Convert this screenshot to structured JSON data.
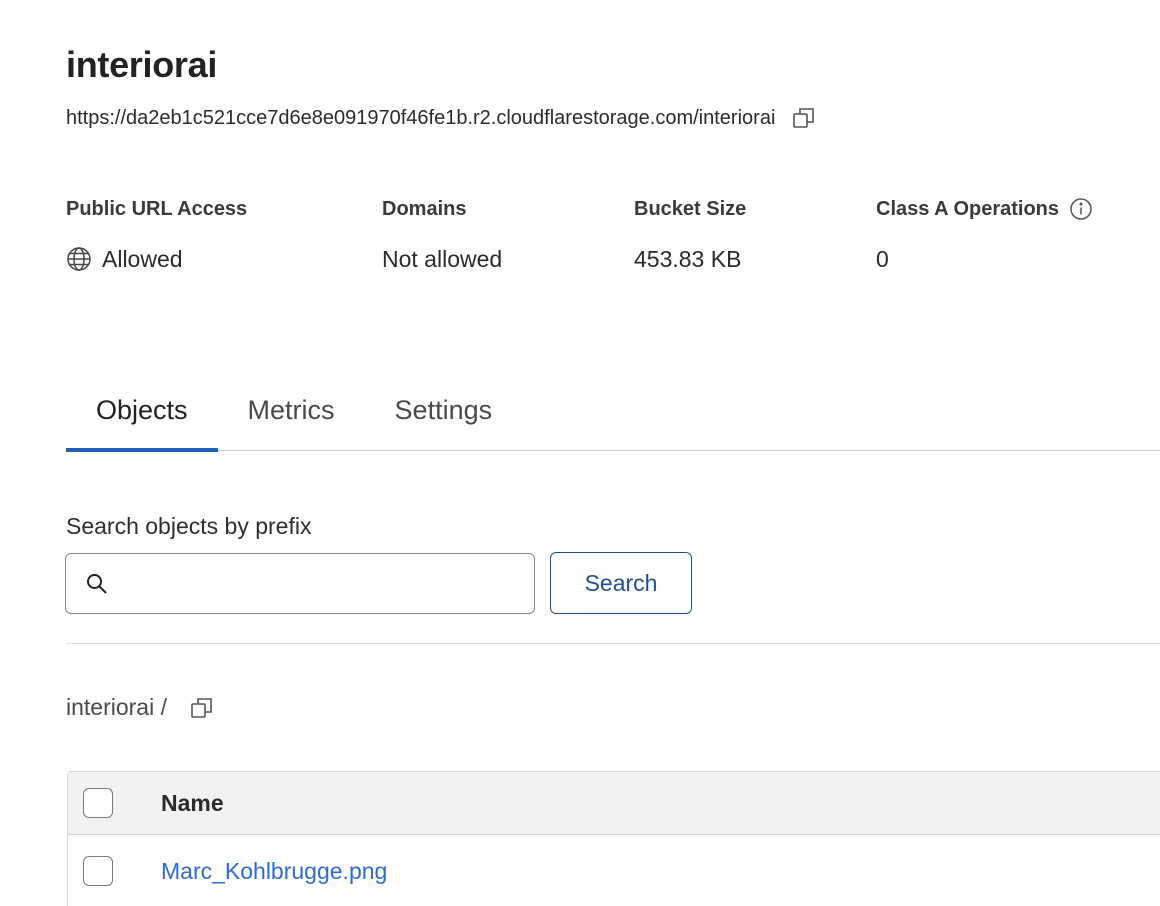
{
  "bucket": {
    "name": "interiorai",
    "url": "https://da2eb1c521cce7d6e8e091970f46fe1b.r2.cloudflarestorage.com/interiorai"
  },
  "stats": [
    {
      "label": "Public URL Access",
      "value": "Allowed",
      "icon": "globe-icon"
    },
    {
      "label": "Domains",
      "value": "Not allowed"
    },
    {
      "label": "Bucket Size",
      "value": "453.83 KB"
    },
    {
      "label": "Class A Operations",
      "value": "0",
      "label_icon": "info-icon"
    }
  ],
  "tabs": [
    {
      "label": "Objects",
      "active": true
    },
    {
      "label": "Metrics",
      "active": false
    },
    {
      "label": "Settings",
      "active": false
    }
  ],
  "search": {
    "label": "Search objects by prefix",
    "value": "",
    "placeholder": "",
    "button_label": "Search"
  },
  "breadcrumb": {
    "path": "interiorai /"
  },
  "table": {
    "columns": [
      "Name"
    ],
    "rows": [
      {
        "name": "Marc_Kohlbrugge.png"
      }
    ]
  },
  "colors": {
    "accent": "#1f5fbf",
    "link": "#2e6ad8",
    "button_border": "#1f4d9c"
  }
}
